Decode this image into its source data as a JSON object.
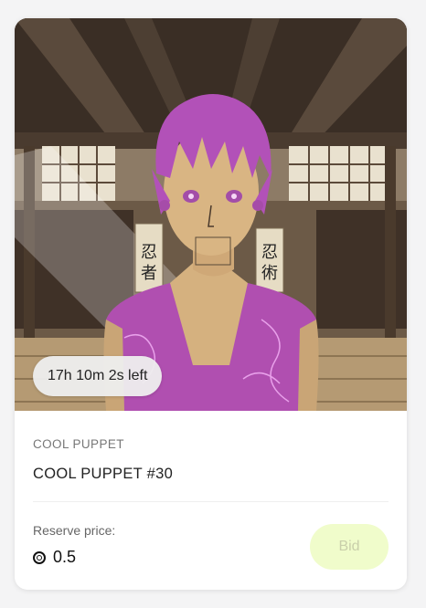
{
  "card": {
    "timer": "17h 10m 2s left",
    "collection": "COOL PUPPET",
    "title": "COOL PUPPET #30",
    "reserve_label": "Reserve price:",
    "price": "0.5",
    "currency_icon": "tezos-icon",
    "bid_label": "Bid",
    "scroll_kanji_left": "忍者",
    "scroll_kanji_right": "忍術"
  },
  "colors": {
    "bid_bg": "#f0fccb",
    "bid_text": "#c9cfaa",
    "hair": "#b251b8",
    "robe": "#b04fb0"
  }
}
